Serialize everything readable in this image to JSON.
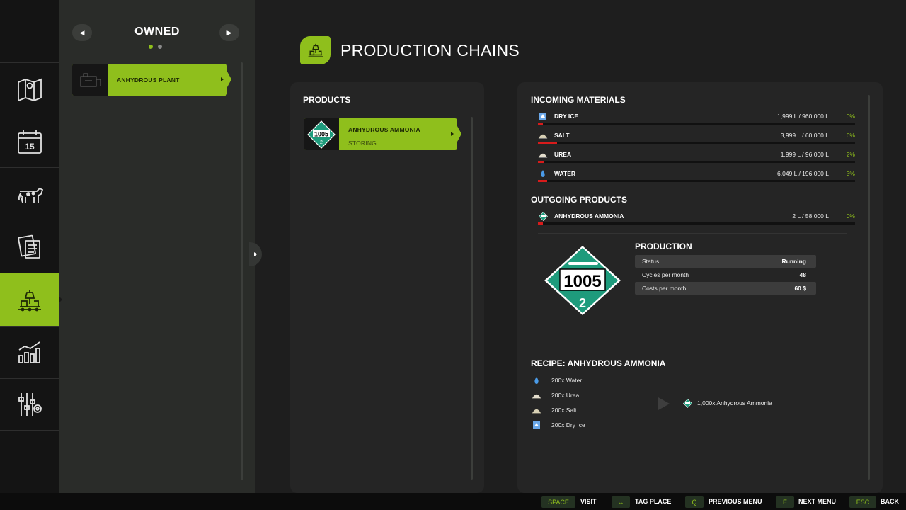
{
  "owned": {
    "title": "OWNED",
    "items": [
      {
        "label": "ANHYDROUS PLANT"
      }
    ]
  },
  "header": {
    "title": "PRODUCTION CHAINS"
  },
  "products": {
    "title": "PRODUCTS",
    "items": [
      {
        "name": "ANHYDROUS AMMONIA",
        "status": "STORING"
      }
    ]
  },
  "incoming": {
    "title": "INCOMING MATERIALS",
    "items": [
      {
        "name": "DRY ICE",
        "amount": "1,999 L / 960,000 L",
        "percent": "0%",
        "fill": 0.01,
        "icon": "dry-ice-icon"
      },
      {
        "name": "SALT",
        "amount": "3,999 L / 60,000 L",
        "percent": "6%",
        "fill": 0.06,
        "icon": "salt-icon"
      },
      {
        "name": "UREA",
        "amount": "1,999 L / 96,000 L",
        "percent": "2%",
        "fill": 0.02,
        "icon": "urea-icon"
      },
      {
        "name": "WATER",
        "amount": "6,049 L / 196,000 L",
        "percent": "3%",
        "fill": 0.03,
        "icon": "water-icon"
      }
    ]
  },
  "outgoing": {
    "title": "OUTGOING PRODUCTS",
    "items": [
      {
        "name": "ANHYDROUS AMMONIA",
        "amount": "2 L / 58,000 L",
        "percent": "0%",
        "fill": 0.01,
        "icon": "ammonia-icon"
      }
    ]
  },
  "production": {
    "title": "PRODUCTION",
    "placard_number": "1005",
    "placard_class": "2",
    "rows": [
      {
        "key": "Status",
        "value": "Running"
      },
      {
        "key": "Cycles per month",
        "value": "48"
      },
      {
        "key": "Costs per month",
        "value": "60 $"
      }
    ]
  },
  "recipe": {
    "title": "RECIPE: ANHYDROUS AMMONIA",
    "inputs": [
      {
        "text": "200x Water",
        "icon": "water-icon"
      },
      {
        "text": "200x Urea",
        "icon": "urea-icon"
      },
      {
        "text": "200x Salt",
        "icon": "salt-icon"
      },
      {
        "text": "200x Dry Ice",
        "icon": "dry-ice-icon"
      }
    ],
    "output": {
      "text": "1,000x Anhydrous Ammonia",
      "icon": "ammonia-icon"
    }
  },
  "footer": {
    "actions": [
      {
        "key": "SPACE",
        "label": "VISIT"
      },
      {
        "key": "↔",
        "label": "TAG PLACE"
      },
      {
        "key": "Q",
        "label": "PREVIOUS MENU"
      },
      {
        "key": "E",
        "label": "NEXT MENU"
      },
      {
        "key": "ESC",
        "label": "BACK"
      }
    ]
  },
  "colors": {
    "accent": "#8fbf1c",
    "bar_fill": "#d81b1b",
    "placard_green": "#1e9b7c"
  }
}
